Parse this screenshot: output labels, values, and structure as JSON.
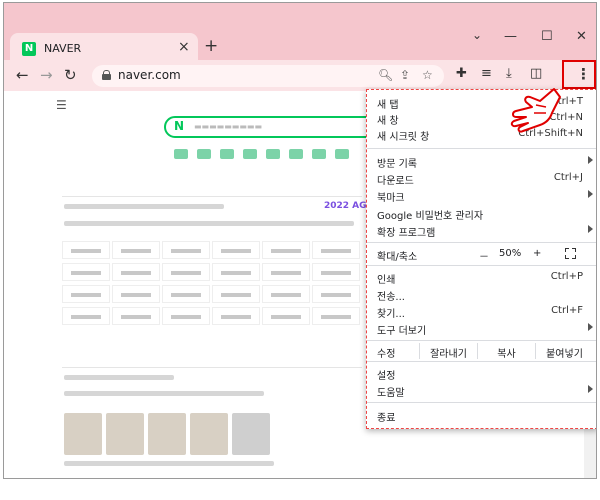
{
  "tab": {
    "favicon": "N",
    "title": "NAVER"
  },
  "toolbar": {
    "url": "naver.com"
  },
  "window": {
    "chevron": "⌄",
    "minimize": "—",
    "maximize": "☐",
    "close": "✕"
  },
  "menu": {
    "new_tab": {
      "label": "새 탭",
      "shortcut": "Ctrl+T"
    },
    "new_window": {
      "label": "새 창",
      "shortcut": "Ctrl+N"
    },
    "incognito": {
      "label": "새 시크릿 창",
      "shortcut": "Ctrl+Shift+N"
    },
    "history": {
      "label": "방문 기록"
    },
    "downloads": {
      "label": "다운로드",
      "shortcut": "Ctrl+J"
    },
    "bookmarks": {
      "label": "북마크"
    },
    "passwords": {
      "label": "Google 비밀번호 관리자"
    },
    "extensions": {
      "label": "확장 프로그램"
    },
    "zoom": {
      "label": "확대/축소",
      "minus": "－",
      "value": "50%",
      "plus": "+"
    },
    "print": {
      "label": "인쇄",
      "shortcut": "Ctrl+P"
    },
    "cast": {
      "label": "전송..."
    },
    "find": {
      "label": "찾기...",
      "shortcut": "Ctrl+F"
    },
    "more_tools": {
      "label": "도구 더보기"
    },
    "edit": {
      "label": "수정",
      "cut": "잘라내기",
      "copy": "복사",
      "paste": "붙여넣기"
    },
    "settings": {
      "label": "설정"
    },
    "help": {
      "label": "도움말"
    },
    "exit": {
      "label": "종료"
    }
  },
  "page": {
    "ag_label": "2022 AG"
  },
  "colors": {
    "titlebar": "#f5c6cd",
    "toolbar": "#fbe3e6",
    "highlight": "#e00000",
    "naver_green": "#03c75a"
  }
}
